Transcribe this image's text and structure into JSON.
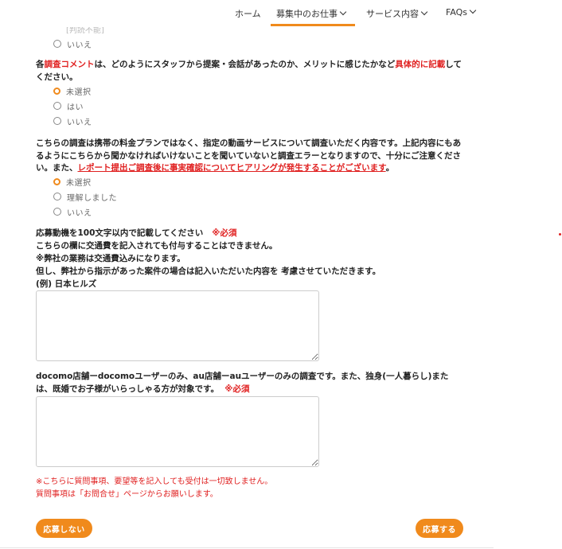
{
  "nav": {
    "home": "ホーム",
    "jobs": "募集中のお仕事",
    "services": "サービス内容",
    "faqs": "FAQs"
  },
  "cutoff_text": "[判読不能]",
  "q_prev": {
    "options": [
      "いいえ"
    ]
  },
  "q_comment": {
    "prefix": "各",
    "red1": "調査コメント",
    "mid": "は、どのようにスタッフから提案・会話があったのか、メリットに感じたかなど",
    "red2": "具体的に記載",
    "suffix": "してください。",
    "options": [
      "未選択",
      "はい",
      "いいえ"
    ],
    "selected": 0
  },
  "q_confirm": {
    "text": "こちらの調査は携帯の料金プランではなく、指定の動画サービスについて調査いただく内容です。上記内容にもあるようにこちらから聞かなければいけないことを聞いていないと調査エラーとなりますので、十分にご注意ください。また、",
    "red": "レポート提出ご調査後に事実確認についてヒアリングが発生することがございます",
    "suffix": "。",
    "options": [
      "未選択",
      "理解しました",
      "いいえ"
    ],
    "selected": 0
  },
  "motive": {
    "line1": "応募動機を100文字以内で記載してください",
    "required": "※必須",
    "line2": "こちらの欄に交通費を記入されても付与することはできません。",
    "line3": "※弊社の業務は交通費込みになります。",
    "line4": "但し、弊社から指示があった案件の場合は記入いただいた内容を 考慮させていただきます。",
    "line5": "(例) 日本ヒルズ"
  },
  "docomo": {
    "text": "docomo店舗ーdocomoユーザーのみ、au店舗ーauユーザーのみの調査です。また、独身(一人暮らし)または、既婚でお子様がいらっしゃる方が対象です。",
    "required": "※必須"
  },
  "notes": {
    "line1": "※こちらに質問事項、要望等を記入しても受付は一切致しません。",
    "line2": "質問事項は「お問合せ」ページからお願いします。"
  },
  "buttons": {
    "decline": "応募しない",
    "apply": "応募する"
  },
  "colors": {
    "accent": "#f08a1c",
    "required_red": "#e02020"
  }
}
